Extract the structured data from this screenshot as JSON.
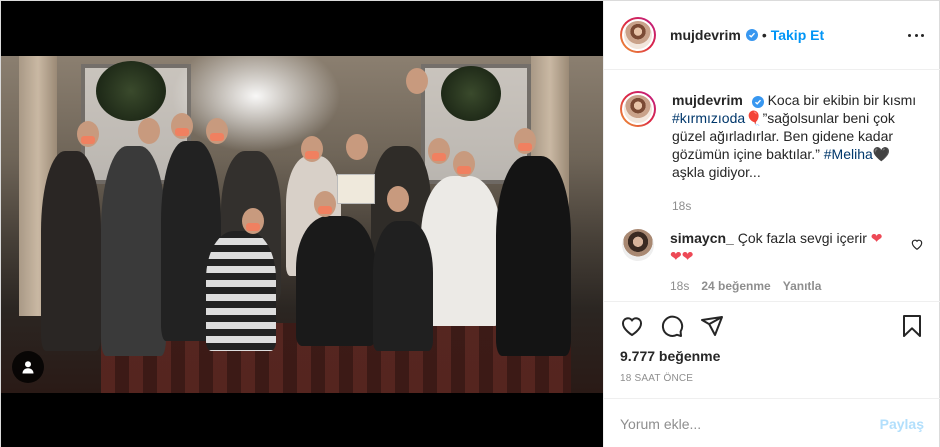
{
  "post": {
    "username": "mujdevrim",
    "follow_label": "Takip Et",
    "separator": "•",
    "caption": {
      "username": "mujdevrim",
      "text_1": "Koca bir ekibin bir kısmı",
      "hashtag_1": "#kırmızıoda",
      "balloon": "🎈",
      "text_2": "”sağolsunlar beni çok güzel ağırladırlar. Ben gidene kadar gözümün içine baktılar.”",
      "hashtag_2": "#Meliha",
      "heart": "🖤",
      "text_3": "aşkla gidiyor...",
      "time": "18s"
    },
    "comment": {
      "username": "simaycn_",
      "text": "Çok fazla sevgi içerir",
      "hearts_1": "❤",
      "hearts_2": "❤❤",
      "time": "18s",
      "likes": "24 beğenme",
      "reply_label": "Yanıtla"
    },
    "likes": "9.777 beğenme",
    "ago": "18 SAAT ÖNCE",
    "comment_input": {
      "placeholder": "Yorum ekle...",
      "value": ""
    },
    "post_label": "Paylaş"
  },
  "icons": {
    "verified": "verified-badge-icon",
    "more": "more-options-icon",
    "like": "heart-outline-icon",
    "comment": "comment-bubble-icon",
    "share": "paper-plane-icon",
    "save": "bookmark-icon",
    "tags": "user-tag-icon"
  },
  "colors": {
    "accent": "#0095f6",
    "heart": "#ed4956",
    "muted": "#8e8e8e"
  }
}
